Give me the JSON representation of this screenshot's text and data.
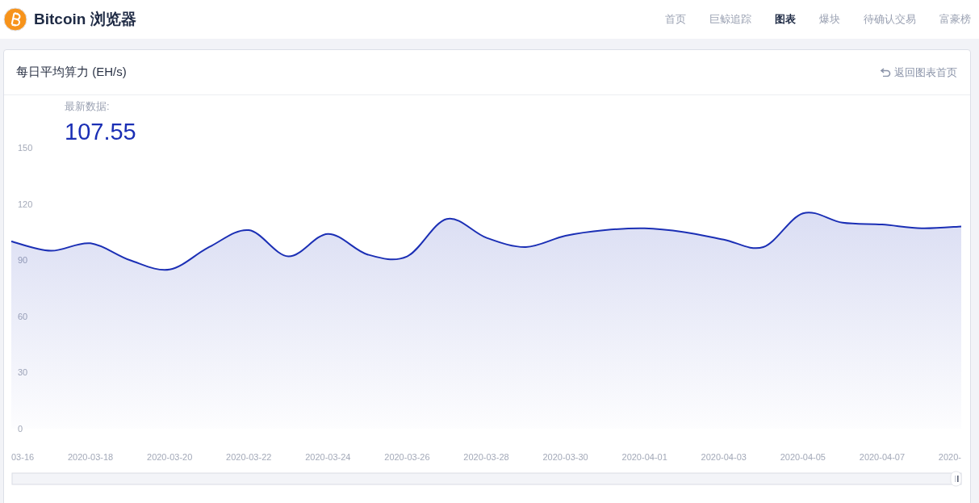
{
  "brand": {
    "name": "Bitcoin 浏览器"
  },
  "nav": [
    {
      "label": "首页",
      "selected": false
    },
    {
      "label": "巨鲸追踪",
      "selected": false
    },
    {
      "label": "图表",
      "selected": true
    },
    {
      "label": "爆块",
      "selected": false
    },
    {
      "label": "待确认交易",
      "selected": false
    },
    {
      "label": "富豪榜",
      "selected": false
    }
  ],
  "card": {
    "title": "每日平均算力 (EH/s)",
    "back_link": "返回图表首页",
    "latest_label": "最新数据:",
    "latest_value": "107.55"
  },
  "chart_data": {
    "type": "area",
    "ylim": [
      0,
      150
    ],
    "yticks": [
      0,
      30,
      60,
      90,
      120,
      150
    ],
    "xlim": [
      "2020-03-16",
      "2020-04-09"
    ],
    "x": [
      "2020-03-16",
      "2020-03-17",
      "2020-03-18",
      "2020-03-19",
      "2020-03-20",
      "2020-03-21",
      "2020-03-22",
      "2020-03-23",
      "2020-03-24",
      "2020-03-25",
      "2020-03-26",
      "2020-03-27",
      "2020-03-28",
      "2020-03-29",
      "2020-03-30",
      "2020-03-31",
      "2020-04-01",
      "2020-04-02",
      "2020-04-03",
      "2020-04-04",
      "2020-04-05",
      "2020-04-06",
      "2020-04-07",
      "2020-04-08",
      "2020-04-09"
    ],
    "xticks": [
      {
        "value": "2020-03-18",
        "label": "2020-03-18"
      },
      {
        "value": "2020-03-20",
        "label": "2020-03-20"
      },
      {
        "value": "2020-03-22",
        "label": "2020-03-22"
      },
      {
        "value": "2020-03-24",
        "label": "2020-03-24"
      },
      {
        "value": "2020-03-26",
        "label": "2020-03-26"
      },
      {
        "value": "2020-03-28",
        "label": "2020-03-28"
      },
      {
        "value": "2020-03-30",
        "label": "2020-03-30"
      },
      {
        "value": "2020-04-01",
        "label": "2020-04-01"
      },
      {
        "value": "2020-04-03",
        "label": "2020-04-03"
      },
      {
        "value": "2020-04-05",
        "label": "2020-04-05"
      },
      {
        "value": "2020-04-07",
        "label": "2020-04-07"
      }
    ],
    "series": [
      {
        "color": "#1b2fb5",
        "values": [
          100,
          95,
          99,
          90,
          85,
          97,
          106,
          92,
          104,
          93,
          92,
          112,
          102,
          97,
          103,
          106,
          107,
          105,
          101,
          97,
          115,
          110,
          109,
          107,
          108
        ]
      }
    ]
  },
  "cut_axis_labels": {
    "left": "03-16",
    "right": "2020-"
  }
}
